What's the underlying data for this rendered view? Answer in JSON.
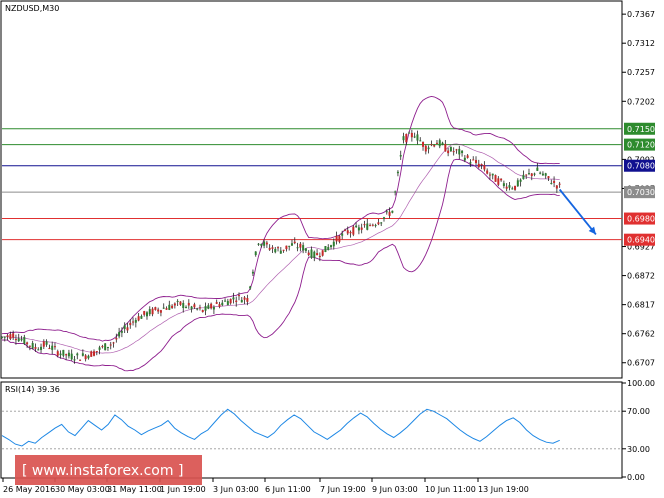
{
  "chart_data": [
    {
      "type": "candlestick",
      "title": "NZDUSD,M30",
      "ylim": [
        0.668,
        0.739
      ],
      "y_ticks": [
        "0.7367",
        "0.7312",
        "0.7257",
        "0.7202",
        "0.7092",
        "0.7037",
        "0.6927",
        "0.6872",
        "0.6817",
        "0.6762",
        "0.6707"
      ],
      "x_labels": [
        "26 May 2016",
        "30 May 03:00",
        "31 May 11:00",
        "1 Jun 19:00",
        "3 Jun 03:00",
        "6 Jun 11:00",
        "7 Jun 19:00",
        "9 Jun 03:00",
        "10 Jun 11:00",
        "13 Jun 19:00"
      ],
      "levels": [
        {
          "label": "0.7150",
          "value": 0.715,
          "color": "#2e8b2e"
        },
        {
          "label": "0.7120",
          "value": 0.712,
          "color": "#2e8b2e"
        },
        {
          "label": "0.7080",
          "value": 0.708,
          "color": "#101090"
        },
        {
          "label": "0.7030",
          "value": 0.703,
          "color": "#8c8c8c"
        },
        {
          "label": "0.6980",
          "value": 0.698,
          "color": "#e03030"
        },
        {
          "label": "0.6940",
          "value": 0.694,
          "color": "#e03030"
        }
      ],
      "price_path": [
        {
          "t": 0,
          "y": 0.6755
        },
        {
          "t": 4,
          "y": 0.676
        },
        {
          "t": 8,
          "y": 0.6748
        },
        {
          "t": 12,
          "y": 0.6735
        },
        {
          "t": 16,
          "y": 0.6742
        },
        {
          "t": 20,
          "y": 0.6728
        },
        {
          "t": 24,
          "y": 0.672
        },
        {
          "t": 28,
          "y": 0.6718
        },
        {
          "t": 32,
          "y": 0.6724
        },
        {
          "t": 36,
          "y": 0.6735
        },
        {
          "t": 40,
          "y": 0.6745
        },
        {
          "t": 44,
          "y": 0.677
        },
        {
          "t": 48,
          "y": 0.679
        },
        {
          "t": 52,
          "y": 0.68
        },
        {
          "t": 56,
          "y": 0.6808
        },
        {
          "t": 60,
          "y": 0.6813
        },
        {
          "t": 64,
          "y": 0.6818
        },
        {
          "t": 68,
          "y": 0.6812
        },
        {
          "t": 72,
          "y": 0.6805
        },
        {
          "t": 76,
          "y": 0.6815
        },
        {
          "t": 80,
          "y": 0.6822
        },
        {
          "t": 84,
          "y": 0.683
        },
        {
          "t": 88,
          "y": 0.6828
        },
        {
          "t": 92,
          "y": 0.6938
        },
        {
          "t": 96,
          "y": 0.6925
        },
        {
          "t": 100,
          "y": 0.692
        },
        {
          "t": 104,
          "y": 0.693
        },
        {
          "t": 108,
          "y": 0.6925
        },
        {
          "t": 112,
          "y": 0.691
        },
        {
          "t": 116,
          "y": 0.692
        },
        {
          "t": 120,
          "y": 0.694
        },
        {
          "t": 124,
          "y": 0.6955
        },
        {
          "t": 128,
          "y": 0.696
        },
        {
          "t": 132,
          "y": 0.6968
        },
        {
          "t": 136,
          "y": 0.6978
        },
        {
          "t": 140,
          "y": 0.6995
        },
        {
          "t": 144,
          "y": 0.713
        },
        {
          "t": 148,
          "y": 0.714
        },
        {
          "t": 152,
          "y": 0.7115
        },
        {
          "t": 156,
          "y": 0.7125
        },
        {
          "t": 160,
          "y": 0.711
        },
        {
          "t": 164,
          "y": 0.7105
        },
        {
          "t": 168,
          "y": 0.709
        },
        {
          "t": 172,
          "y": 0.708
        },
        {
          "t": 176,
          "y": 0.7058
        },
        {
          "t": 180,
          "y": 0.7045
        },
        {
          "t": 184,
          "y": 0.704
        },
        {
          "t": 188,
          "y": 0.706
        },
        {
          "t": 192,
          "y": 0.707
        },
        {
          "t": 196,
          "y": 0.7055
        },
        {
          "t": 200,
          "y": 0.704
        }
      ],
      "arrow": {
        "from": {
          "t": 200,
          "y": 0.7035
        },
        "to": {
          "t": 213,
          "y": 0.695
        },
        "color": "#1565e0"
      }
    },
    {
      "type": "line",
      "title": "RSI(14) 39.36",
      "ylim": [
        0,
        100
      ],
      "y_ticks": [
        "100.00",
        "70.00",
        "30.00",
        "0.00"
      ],
      "guide_levels": [
        70,
        30
      ],
      "values": [
        44,
        40,
        35,
        33,
        38,
        36,
        42,
        47,
        52,
        56,
        48,
        44,
        52,
        60,
        55,
        50,
        56,
        66,
        61,
        54,
        50,
        45,
        49,
        52,
        55,
        60,
        52,
        47,
        43,
        40,
        46,
        50,
        58,
        66,
        72,
        67,
        60,
        54,
        48,
        45,
        42,
        47,
        55,
        61,
        66,
        62,
        55,
        48,
        44,
        40,
        45,
        50,
        57,
        63,
        68,
        64,
        57,
        51,
        46,
        42,
        47,
        53,
        60,
        67,
        72,
        70,
        66,
        62,
        56,
        50,
        45,
        41,
        38,
        43,
        49,
        55,
        60,
        63,
        58,
        50,
        44,
        40,
        37,
        36,
        39
      ]
    }
  ],
  "watermark": "[  www.instaforex.com ]"
}
